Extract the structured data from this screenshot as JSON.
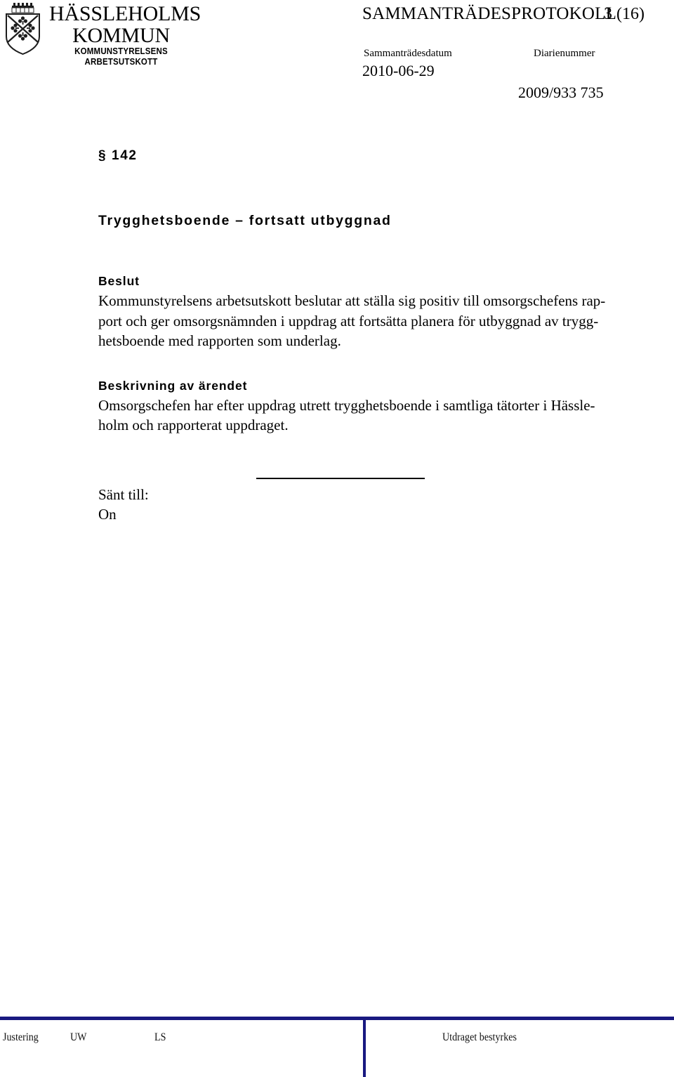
{
  "header": {
    "logo": {
      "crest_icon": "hassleholm-coat-of-arms-icon",
      "wordmark_line1": "HÄSSLEHOLMS",
      "wordmark_line2": "KOMMUN",
      "suborg_line1": "KOMMUNSTYRELSENS",
      "suborg_line2": "ARBETSUTSKOTT"
    },
    "document_kind": "SAMMANTRÄDESPROTOKOLL",
    "page_number": "3 (16)",
    "meeting_date_label": "Sammanträdesdatum",
    "meeting_date_value": "2010-06-29",
    "diary_number_label": "Diarienummer",
    "diary_number_value": "2009/933  735"
  },
  "body": {
    "section_number": "§ 142",
    "title": "Trygghetsboende – fortsatt utbyggnad",
    "decision": {
      "heading": "Beslut",
      "lines": [
        "Kommunstyrelsens arbetsutskott beslutar att ställa sig positiv till omsorgschefens rap-",
        "port och ger omsorgsnämnden i uppdrag att fortsätta planera för utbyggnad av trygg-",
        "hetsboende med rapporten som underlag."
      ]
    },
    "description": {
      "heading": "Beskrivning av ärendet",
      "lines": [
        "Omsorgschefen har efter uppdrag utrett trygghetsboende i samtliga tätorter i Hässle-",
        "holm och rapporterat uppdraget."
      ]
    },
    "sent_to": {
      "label": "Sänt till:",
      "value": "On"
    }
  },
  "footer": {
    "justering_label": "Justering",
    "signature_1": "UW",
    "signature_2": "LS",
    "certified_label": "Utdraget bestyrkes",
    "rule_color": "#191980"
  }
}
